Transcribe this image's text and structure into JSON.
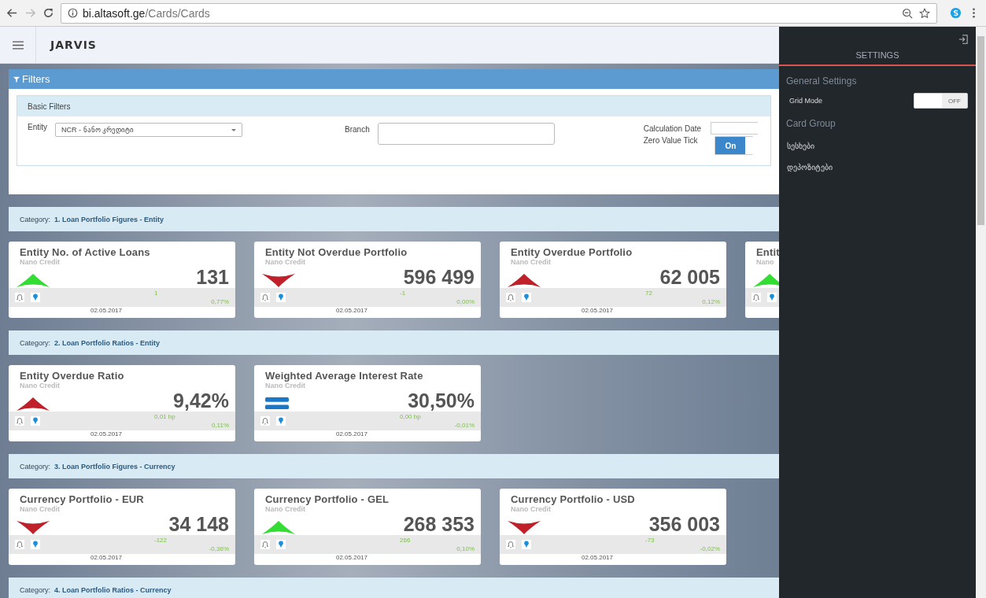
{
  "browser": {
    "url_host": "bi.altasoft.ge",
    "url_path": "/Cards/Cards",
    "forward_disabled": true
  },
  "app": {
    "title": "JARVIS"
  },
  "filters": {
    "title": "Filters",
    "section": "Basic Filters",
    "entity_label": "Entity",
    "entity_value": "NCR - ნანო კრედიტი",
    "branch_label": "Branch",
    "date_label": "Calculation Date",
    "zero_label": "Zero Value Tick",
    "zero_toggle": {
      "label": "On",
      "on": true
    }
  },
  "categories": [
    {
      "prefix": "Category:",
      "name": "1. Loan Portfolio Figures - Entity",
      "cards": [
        {
          "title": "Entity No. of Active Loans",
          "subtitle": "Nano Credit",
          "value": "131",
          "kind": "up",
          "color": "#33dd33",
          "change": "1",
          "percent": "0,77%",
          "date": "02.05.2017"
        },
        {
          "title": "Entity Not Overdue Portfolio",
          "subtitle": "Nano Credit",
          "value": "596 499",
          "kind": "down",
          "color": "#c0202a",
          "change": "-1",
          "percent": "0,00%",
          "date": "02.05.2017"
        },
        {
          "title": "Entity Overdue Portfolio",
          "subtitle": "Nano Credit",
          "value": "62 005",
          "kind": "up",
          "color": "#c0202a",
          "change": "72",
          "percent": "0,12%",
          "date": "02.05.2017"
        },
        {
          "title": "Entit",
          "subtitle": "Nano",
          "kind": "up",
          "color": "#33dd33"
        }
      ]
    },
    {
      "prefix": "Category:",
      "name": "2. Loan Portfolio Ratios - Entity",
      "cards": [
        {
          "title": "Entity Overdue Ratio",
          "subtitle": "Nano Credit",
          "value": "9,42%",
          "kind": "up",
          "color": "#c0202a",
          "change": "0,01 bp",
          "percent": "0,11%",
          "date": "02.05.2017"
        },
        {
          "title": "Weighted Average Interest Rate",
          "subtitle": "Nano Credit",
          "value": "30,50%",
          "kind": "flat",
          "color": "#1a78c8",
          "change": "0,00 bp",
          "percent": "-0,01%",
          "date": "02.05.2017"
        }
      ]
    },
    {
      "prefix": "Category:",
      "name": "3. Loan Portfolio Figures - Currency",
      "cards": [
        {
          "title": "Currency Portfolio - EUR",
          "subtitle": "Nano Credit",
          "value": "34 148",
          "kind": "down",
          "color": "#c0202a",
          "change": "-122",
          "percent": "-0,36%",
          "date": "02.05.2017"
        },
        {
          "title": "Currency Portfolio - GEL",
          "subtitle": "Nano Credit",
          "value": "268 353",
          "kind": "up",
          "color": "#33dd33",
          "change": "266",
          "percent": "0,10%",
          "date": "02.05.2017"
        },
        {
          "title": "Currency Portfolio - USD",
          "subtitle": "Nano Credit",
          "value": "356 003",
          "kind": "down",
          "color": "#c0202a",
          "change": "-73",
          "percent": "-0,02%",
          "date": "02.05.2017"
        }
      ]
    },
    {
      "prefix": "Category:",
      "name": "4. Loan Portfolio Ratios - Currency"
    }
  ],
  "settings": {
    "title": "SETTINGS",
    "general": "General Settings",
    "grid_label": "Grid Mode",
    "grid_toggle": {
      "label": "OFF",
      "on": false
    },
    "card_group": "Card Group",
    "groups": [
      "სესხები",
      "დეპოზიტები"
    ]
  }
}
